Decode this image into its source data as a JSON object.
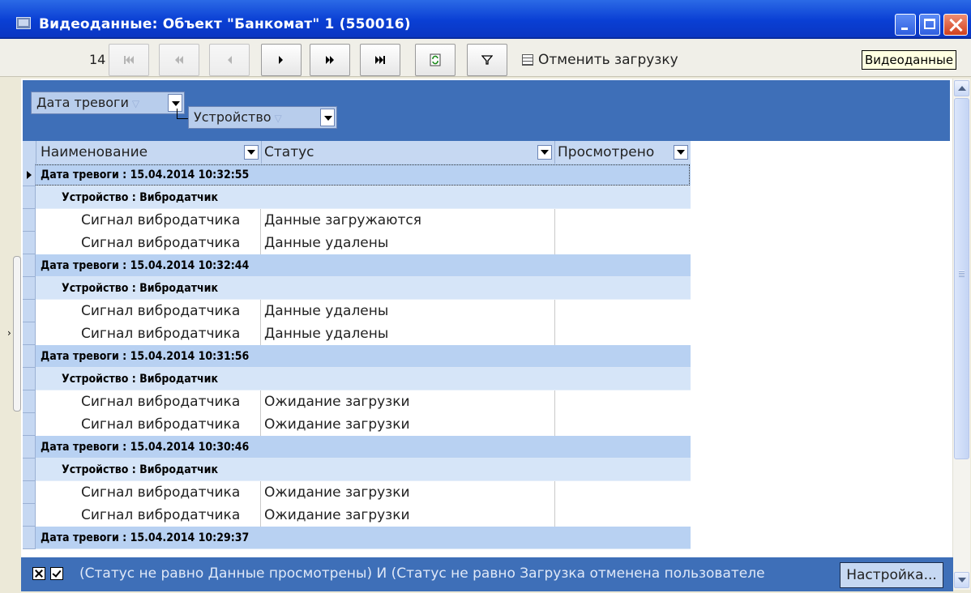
{
  "window": {
    "title": "Видеоданные: Объект \"Банкомат\" 1 (550016)"
  },
  "toolbar": {
    "page_number": "14",
    "cancel_load_label": "Отменить загрузку",
    "tooltip": "Видеоданные"
  },
  "group_panel": {
    "group1_label": "Дата тревоги",
    "group2_label": "Устройство"
  },
  "columns": {
    "name": "Наименование",
    "status": "Статус",
    "viewed": "Просмотрено"
  },
  "rows": [
    {
      "type": "g1",
      "text": "Дата тревоги : 15.04.2014 10:32:55"
    },
    {
      "type": "g2",
      "text": "Устройство : Вибродатчик"
    },
    {
      "type": "d",
      "name": "Сигнал вибродатчика",
      "status": "Данные загружаются",
      "viewed": ""
    },
    {
      "type": "d",
      "name": "Сигнал вибродатчика",
      "status": "Данные удалены",
      "viewed": ""
    },
    {
      "type": "g1",
      "text": "Дата тревоги : 15.04.2014 10:32:44"
    },
    {
      "type": "g2",
      "text": "Устройство : Вибродатчик"
    },
    {
      "type": "d",
      "name": "Сигнал вибродатчика",
      "status": "Данные удалены",
      "viewed": ""
    },
    {
      "type": "d",
      "name": "Сигнал вибродатчика",
      "status": "Данные удалены",
      "viewed": ""
    },
    {
      "type": "g1",
      "text": "Дата тревоги : 15.04.2014 10:31:56"
    },
    {
      "type": "g2",
      "text": "Устройство : Вибродатчик"
    },
    {
      "type": "d",
      "name": "Сигнал вибродатчика",
      "status": "Ожидание загрузки",
      "viewed": ""
    },
    {
      "type": "d",
      "name": "Сигнал вибродатчика",
      "status": "Ожидание загрузки",
      "viewed": ""
    },
    {
      "type": "g1",
      "text": "Дата тревоги : 15.04.2014 10:30:46"
    },
    {
      "type": "g2",
      "text": "Устройство : Вибродатчик"
    },
    {
      "type": "d",
      "name": "Сигнал вибродатчика",
      "status": "Ожидание загрузки",
      "viewed": ""
    },
    {
      "type": "d",
      "name": "Сигнал вибродатчика",
      "status": "Ожидание загрузки",
      "viewed": ""
    },
    {
      "type": "g1",
      "text": "Дата тревоги : 15.04.2014 10:29:37"
    }
  ],
  "filter": {
    "text": "(Статус не равно Данные просмотрены) И (Статус не равно Загрузка отменена пользователе",
    "settings_label": "Настройка..."
  }
}
